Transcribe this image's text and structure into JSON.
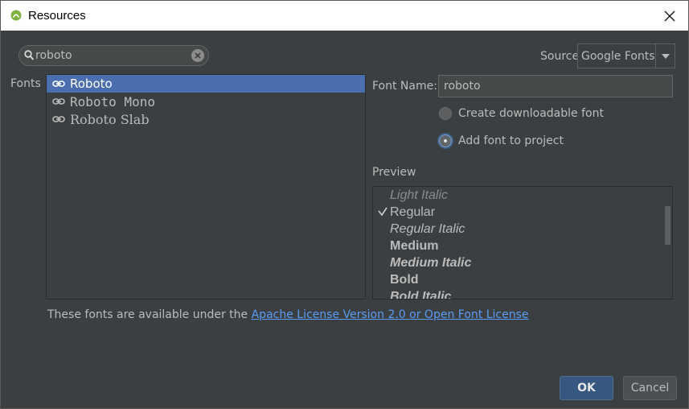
{
  "window": {
    "title": "Resources"
  },
  "search": {
    "value": "roboto",
    "placeholder": ""
  },
  "source": {
    "label": "Source",
    "selected": "Google Fonts"
  },
  "fonts": {
    "label": "Fonts",
    "items": [
      {
        "label": "Roboto"
      },
      {
        "label": "Roboto Mono"
      },
      {
        "label": "Roboto Slab"
      }
    ]
  },
  "details": {
    "font_name_label": "Font Name:",
    "font_name_value": "roboto",
    "option_downloadable": "Create downloadable font",
    "option_add_to_project": "Add font to project",
    "selected_option": "Add font to project"
  },
  "preview": {
    "label": "Preview",
    "items": [
      {
        "label": "Light Italic"
      },
      {
        "label": "Regular",
        "checked": true
      },
      {
        "label": "Regular Italic"
      },
      {
        "label": "Medium"
      },
      {
        "label": "Medium Italic"
      },
      {
        "label": "Bold"
      },
      {
        "label": "Bold Italic"
      }
    ]
  },
  "license": {
    "text": "These fonts are available under the ",
    "link": "Apache License Version 2.0 or Open Font License"
  },
  "buttons": {
    "ok": "OK",
    "cancel": "Cancel"
  },
  "colors": {
    "background": "#3c3f41",
    "selection": "#4b6eaf",
    "link": "#589df6",
    "ok_button": "#365880"
  }
}
